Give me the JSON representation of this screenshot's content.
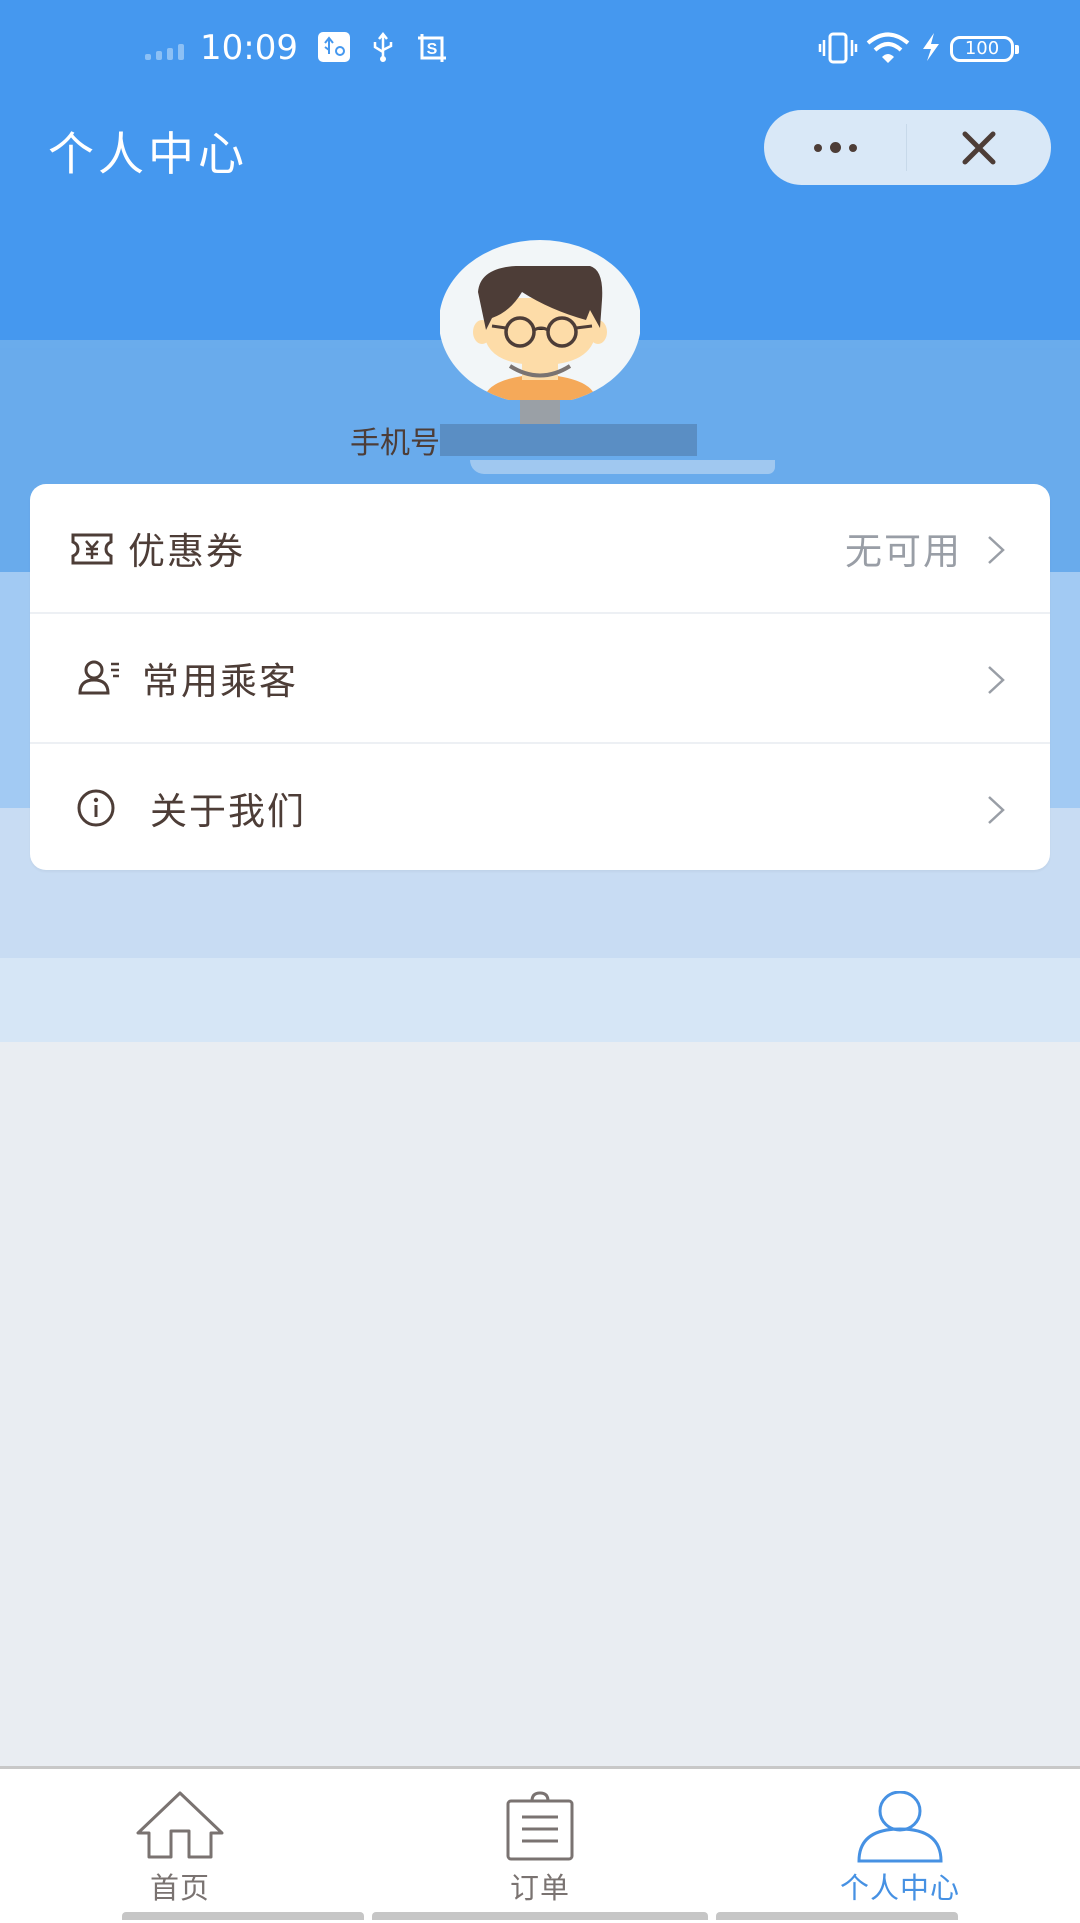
{
  "status_bar": {
    "time": "10:09",
    "battery": "100",
    "icons": [
      "signal-icon",
      "usb-debug-icon",
      "usb-icon",
      "screenshot-icon",
      "vibrate-icon",
      "wifi-icon",
      "charging-icon",
      "battery-icon"
    ]
  },
  "nav": {
    "title": "个人中心",
    "more_icon": "more-dots-icon",
    "close_icon": "close-icon"
  },
  "profile": {
    "avatar_icon": "avatar-cartoon-boy",
    "phone_label": "手机号",
    "phone_value": ""
  },
  "menu": [
    {
      "icon": "coupon-icon",
      "label": "优惠券",
      "value": "无可用"
    },
    {
      "icon": "passenger-icon",
      "label": "常用乘客",
      "value": ""
    },
    {
      "icon": "info-icon",
      "label": "关于我们",
      "value": ""
    }
  ],
  "tabbar": {
    "active": 2,
    "items": [
      {
        "icon": "home-icon",
        "label": "首页"
      },
      {
        "icon": "order-icon",
        "label": "订单"
      },
      {
        "icon": "user-icon",
        "label": "个人中心"
      }
    ]
  },
  "colors": {
    "primary": "#4598ef",
    "active_tab": "#4691e3",
    "text": "#4d3d37",
    "muted": "#999ea6"
  }
}
